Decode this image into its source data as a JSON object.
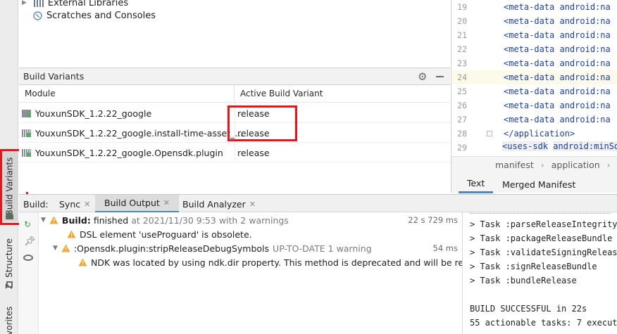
{
  "project_tree": {
    "items": [
      {
        "label": "External Libraries"
      },
      {
        "label": "Scratches and Consoles"
      }
    ]
  },
  "build_variants": {
    "title": "Build Variants",
    "columns": {
      "module": "Module",
      "variant": "Active Build Variant"
    },
    "rows": [
      {
        "module": "YouxunSDK_1.2.22_google",
        "variant": "release"
      },
      {
        "module": "YouxunSDK_1.2.22_google.install-time-asset_...",
        "variant": "release"
      },
      {
        "module": "YouxunSDK_1.2.22_google.Opensdk.plugin",
        "variant": "release"
      }
    ]
  },
  "editor": {
    "lines": [
      {
        "num": "19",
        "code": "<meta-data android:na"
      },
      {
        "num": "20",
        "code": "<meta-data android:na"
      },
      {
        "num": "21",
        "code": "<meta-data android:na"
      },
      {
        "num": "22",
        "code": "<meta-data android:na"
      },
      {
        "num": "23",
        "code": "<meta-data android:na"
      },
      {
        "num": "24",
        "code": "<meta-data android:na"
      },
      {
        "num": "25",
        "code": "<meta-data android:na"
      },
      {
        "num": "26",
        "code": "<meta-data android:na"
      },
      {
        "num": "27",
        "code": "<meta-data android:na"
      }
    ],
    "line28": {
      "num": "28",
      "code": "</application>"
    },
    "line29": {
      "num": "29",
      "tag": "<uses-sdk",
      "attr": "android:minSd"
    },
    "breadcrumb": [
      "manifest",
      "application",
      "m"
    ],
    "tabs": [
      "Text",
      "Merged Manifest"
    ]
  },
  "left_strip": {
    "build_variants": "Build Variants",
    "structure": "Z: Structure",
    "favorites": "avorites"
  },
  "build": {
    "label": "Build:",
    "tabs": [
      {
        "label": "Sync"
      },
      {
        "label": "Build Output"
      },
      {
        "label": "Build Analyzer"
      }
    ],
    "tree": {
      "root_bold": "Build:",
      "root_status": "finished",
      "root_detail": "at 2021/11/30 9:53 with 2 warnings",
      "root_time": "22 s 729 ms",
      "warn1": "DSL element 'useProguard' is obsolete.",
      "task": ":Opensdk.plugin:stripReleaseDebugSymbols",
      "task_status": "UP-TO-DATE 1 warning",
      "task_time": "54 ms",
      "warn2": "NDK was located by using ndk.dir property. This method is deprecated and will be remov"
    },
    "console": [
      "> Task :parseReleaseIntegrityC",
      "> Task :packageReleaseBundle U",
      "> Task :validateSigningRelease",
      "> Task :signReleaseBundle",
      "> Task :bundleRelease",
      "",
      "BUILD SUCCESSFUL in 22s",
      "55 actionable tasks: 7 execute"
    ]
  }
}
